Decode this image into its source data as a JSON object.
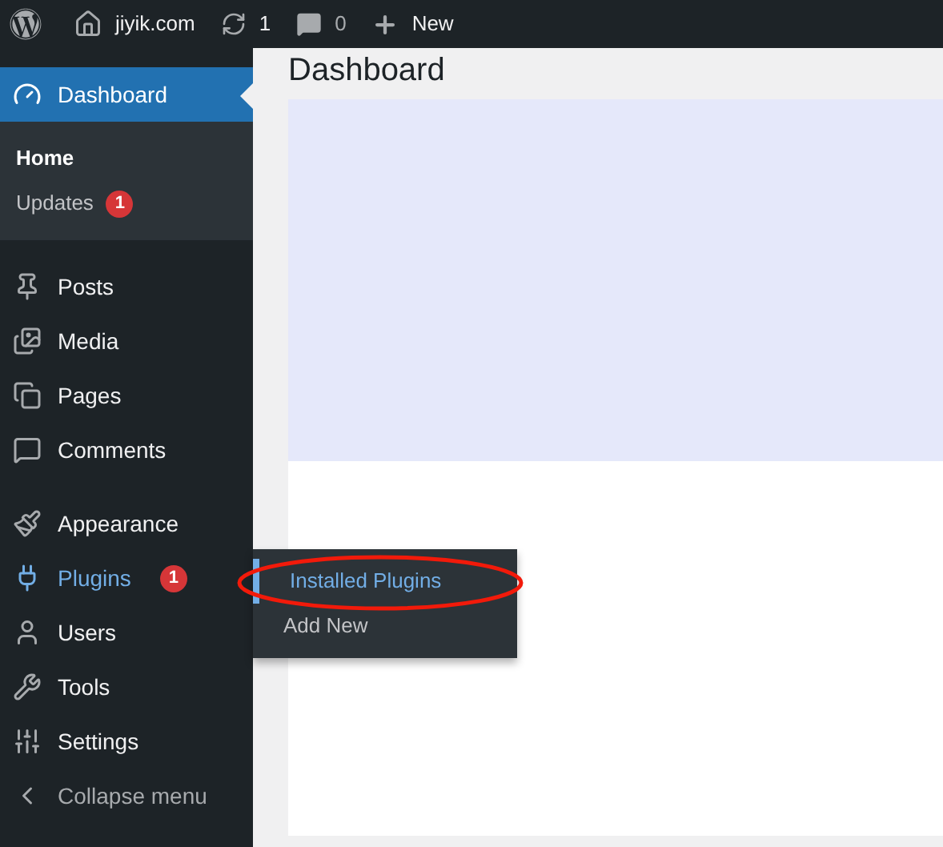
{
  "top_bar": {
    "site": "jiyik.com",
    "updates": "1",
    "comments": "0",
    "new": "New"
  },
  "page_title": "Dashboard",
  "menu_groups": [
    [
      {
        "label": "Dashboard",
        "selected": true,
        "hovered": false,
        "submenu": [
          {
            "label": "Home",
            "selected": true
          },
          {
            "label": "Updates",
            "selected": false,
            "badge": "1"
          }
        ]
      }
    ],
    [
      {
        "label": "Posts",
        "selected": false,
        "hovered": false
      },
      {
        "label": "Media",
        "selected": false,
        "hovered": false
      },
      {
        "label": "Pages",
        "selected": false,
        "hovered": false
      },
      {
        "label": "Comments",
        "selected": false,
        "hovered": false
      }
    ],
    [
      {
        "label": "Appearance",
        "selected": false,
        "hovered": false
      },
      {
        "label": "Plugins",
        "selected": false,
        "hovered": true,
        "badge": "1",
        "flyout": [
          {
            "label": "Installed Plugins",
            "selected": true
          },
          {
            "label": "Add New",
            "selected": false
          }
        ]
      },
      {
        "label": "Users",
        "selected": false,
        "hovered": false
      },
      {
        "label": "Tools",
        "selected": false,
        "hovered": false
      },
      {
        "label": "Settings",
        "selected": false,
        "hovered": false
      },
      {
        "label": "Collapse menu",
        "selected": false,
        "hovered": false
      }
    ]
  ]
}
